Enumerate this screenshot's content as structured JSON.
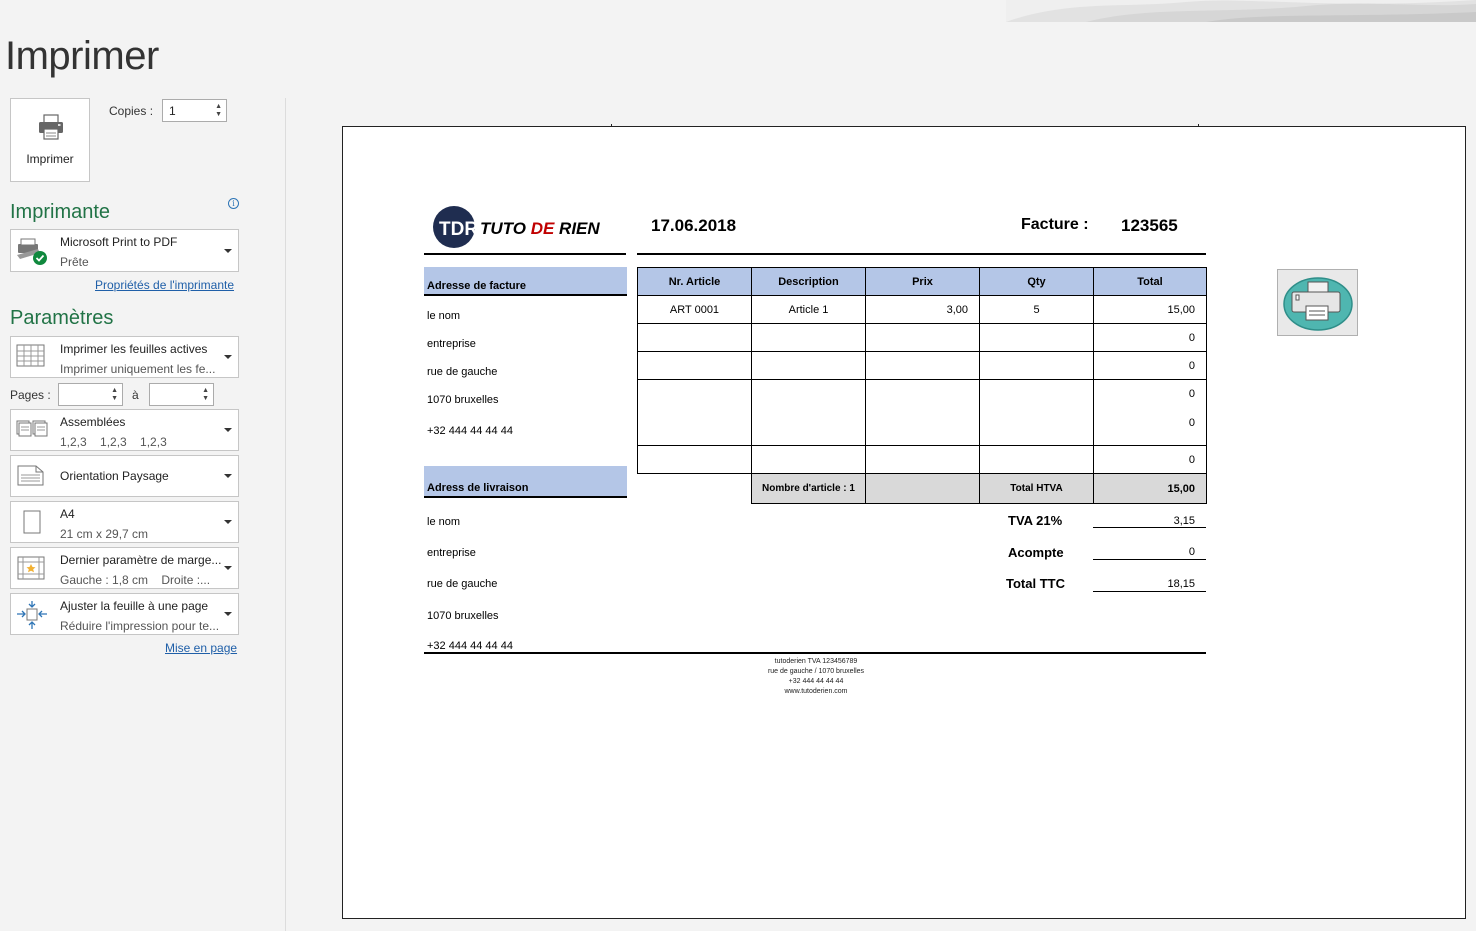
{
  "header": {
    "title": "Imprimer"
  },
  "print_button": {
    "label": "Imprimer"
  },
  "copies": {
    "label": "Copies :",
    "value": "1"
  },
  "printer": {
    "section_title": "Imprimante",
    "info_glyph": "i",
    "name": "Microsoft Print to PDF",
    "status": "Prête",
    "properties_link": "Propriétés de l'imprimante"
  },
  "settings": {
    "section_title": "Paramètres",
    "print_what": {
      "line1": "Imprimer les feuilles actives",
      "line2": "Imprimer uniquement les fe..."
    },
    "pages_label": "Pages :",
    "pages_from": "",
    "pages_to_label": "à",
    "pages_to": "",
    "collate": {
      "line1": "Assemblées",
      "line2": "1,2,3    1,2,3    1,2,3"
    },
    "orientation": {
      "line1": "Orientation Paysage"
    },
    "paper": {
      "line1": "A4",
      "line2": "21 cm x 29,7 cm"
    },
    "margins": {
      "line1": "Dernier paramètre de marge...",
      "line2": "Gauche : 1,8 cm    Droite :..."
    },
    "scaling": {
      "line1": "Ajuster la feuille à une page",
      "line2": "Réduire l'impression pour te..."
    },
    "page_setup_link": "Mise en page"
  },
  "invoice": {
    "logo_initials": "TDR",
    "logo_text_1": "TUTO ",
    "logo_text_2": "DE",
    "logo_text_3": " RIEN",
    "date": "17.06.2018",
    "facture_label": "Facture :",
    "facture_number": "123565",
    "billing": {
      "header": "Adresse de facture",
      "lines": [
        "le nom",
        "entreprise",
        "rue de gauche",
        "1070 bruxelles",
        "+32 444 44 44 44"
      ]
    },
    "delivery": {
      "header": "Adress de livraison",
      "lines": [
        "le nom",
        "entreprise",
        "rue de gauche",
        "1070 bruxelles",
        "+32 444 44 44 44"
      ]
    },
    "table": {
      "headers": [
        "Nr. Article",
        "Description",
        "Prix",
        "Qty",
        "Total"
      ],
      "row1": [
        "ART 0001",
        "Article 1",
        "3,00",
        "5",
        "15,00"
      ],
      "totals": [
        "0",
        "0",
        "0",
        "0",
        "0"
      ],
      "summary": {
        "count_label": "Nombre d'article : 1",
        "htva_label": "Total HTVA",
        "htva_value": "15,00"
      }
    },
    "tva": {
      "label": "TVA 21%",
      "value": "3,15"
    },
    "acompte": {
      "label": "Acompte",
      "value": "0"
    },
    "ttc": {
      "label": "Total TTC",
      "value": "18,15"
    },
    "footer": [
      "tutoderien  TVA 123456789",
      "rue de gauche / 1070 bruxelles",
      "+32 444 44 44 44",
      "www.tutoderien.com"
    ]
  },
  "colors": {
    "accent_green": "#217346",
    "link_blue": "#1f5fa8",
    "table_header_blue": "#b4c6e7",
    "summary_grey": "#d9d9d9",
    "logo_red": "#c00000",
    "logo_navy": "#1f2d50"
  },
  "icons": [
    "printer-icon",
    "pdf-printer-icon",
    "sheets-icon",
    "collate-icon",
    "orientation-icon",
    "paper-icon",
    "margins-icon",
    "scaling-icon",
    "print-macro-button-icon"
  ]
}
